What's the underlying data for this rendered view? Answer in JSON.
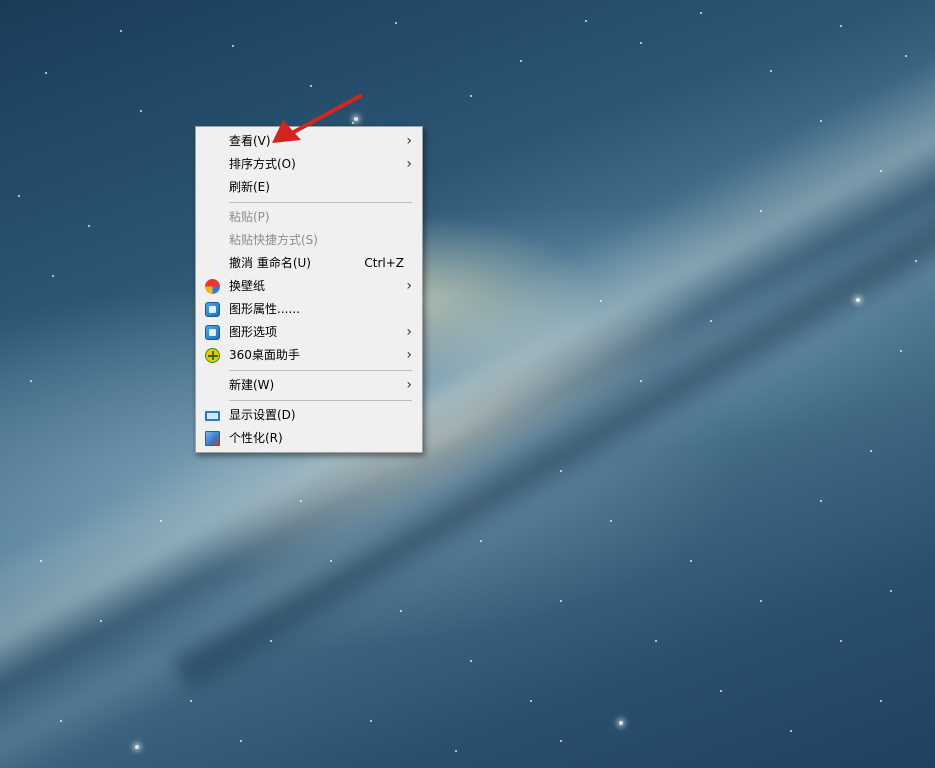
{
  "desktop": {
    "wallpaper": "galaxy"
  },
  "context_menu": {
    "items": [
      {
        "label": "查看(V)",
        "submenu": true,
        "disabled": false
      },
      {
        "label": "排序方式(O)",
        "submenu": true,
        "disabled": false
      },
      {
        "label": "刷新(E)",
        "submenu": false,
        "disabled": false
      },
      {
        "label": "粘贴(P)",
        "submenu": false,
        "disabled": true
      },
      {
        "label": "粘贴快捷方式(S)",
        "submenu": false,
        "disabled": true
      },
      {
        "label": "撤消 重命名(U)",
        "shortcut": "Ctrl+Z",
        "submenu": false,
        "disabled": false
      },
      {
        "label": "换壁纸",
        "submenu": true,
        "disabled": false,
        "icon": "wallpaper-icon"
      },
      {
        "label": "图形属性......",
        "submenu": false,
        "disabled": false,
        "icon": "graphics-icon"
      },
      {
        "label": "图形选项",
        "submenu": true,
        "disabled": false,
        "icon": "graphics-icon"
      },
      {
        "label": "360桌面助手",
        "submenu": true,
        "disabled": false,
        "icon": "360-plus-icon"
      },
      {
        "label": "新建(W)",
        "submenu": true,
        "disabled": false
      },
      {
        "label": "显示设置(D)",
        "submenu": false,
        "disabled": false,
        "icon": "display-icon"
      },
      {
        "label": "个性化(R)",
        "submenu": false,
        "disabled": false,
        "icon": "personalize-icon"
      }
    ],
    "submenu_glyph": "›"
  },
  "annotation": {
    "arrow_color": "#d0261f"
  }
}
